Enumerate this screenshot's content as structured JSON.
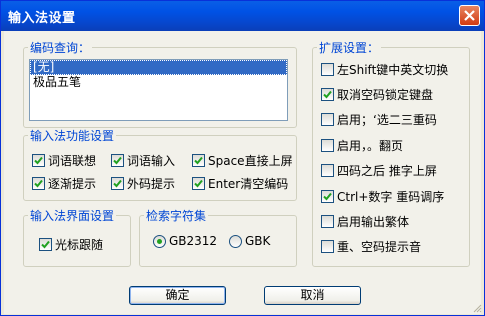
{
  "window": {
    "title": "输入法设置"
  },
  "encoding_query": {
    "legend": "编码查询：",
    "items": [
      {
        "label": "[无]",
        "selected": true
      },
      {
        "label": "极品五笔",
        "selected": false
      }
    ]
  },
  "functions": {
    "legend": "输入法功能设置",
    "checkboxes": [
      {
        "label": "词语联想",
        "checked": true
      },
      {
        "label": "词语输入",
        "checked": true
      },
      {
        "label": "Space直接上屏",
        "checked": true
      },
      {
        "label": "逐渐提示",
        "checked": true
      },
      {
        "label": "外码提示",
        "checked": true
      },
      {
        "label": "Enter清空编码",
        "checked": true
      }
    ]
  },
  "interface": {
    "legend": "输入法界面设置",
    "cursor_follow": {
      "label": "光标跟随",
      "checked": true
    }
  },
  "charset": {
    "legend": "检索字符集",
    "options": [
      {
        "label": "GB2312",
        "selected": true
      },
      {
        "label": "GBK",
        "selected": false
      }
    ]
  },
  "extended": {
    "legend": "扩展设置：",
    "checkboxes": [
      {
        "label": "左Shift键中英文切换",
        "checked": false
      },
      {
        "label": "取消空码锁定键盘",
        "checked": true
      },
      {
        "label": "启用；‘选二三重码",
        "checked": false
      },
      {
        "label": "启用，。翻页",
        "checked": false
      },
      {
        "label": "四码之后 推字上屏",
        "checked": false
      },
      {
        "label": "Ctrl+数字 重码调序",
        "checked": true
      },
      {
        "label": "启用输出繁体",
        "checked": false
      },
      {
        "label": "重、空码提示音",
        "checked": false
      }
    ]
  },
  "buttons": {
    "ok": "确定",
    "cancel": "取消"
  },
  "colors": {
    "titlebar": "#0054e3",
    "legend": "#0046d5",
    "selection": "#316ac5",
    "check": "#21a121"
  }
}
